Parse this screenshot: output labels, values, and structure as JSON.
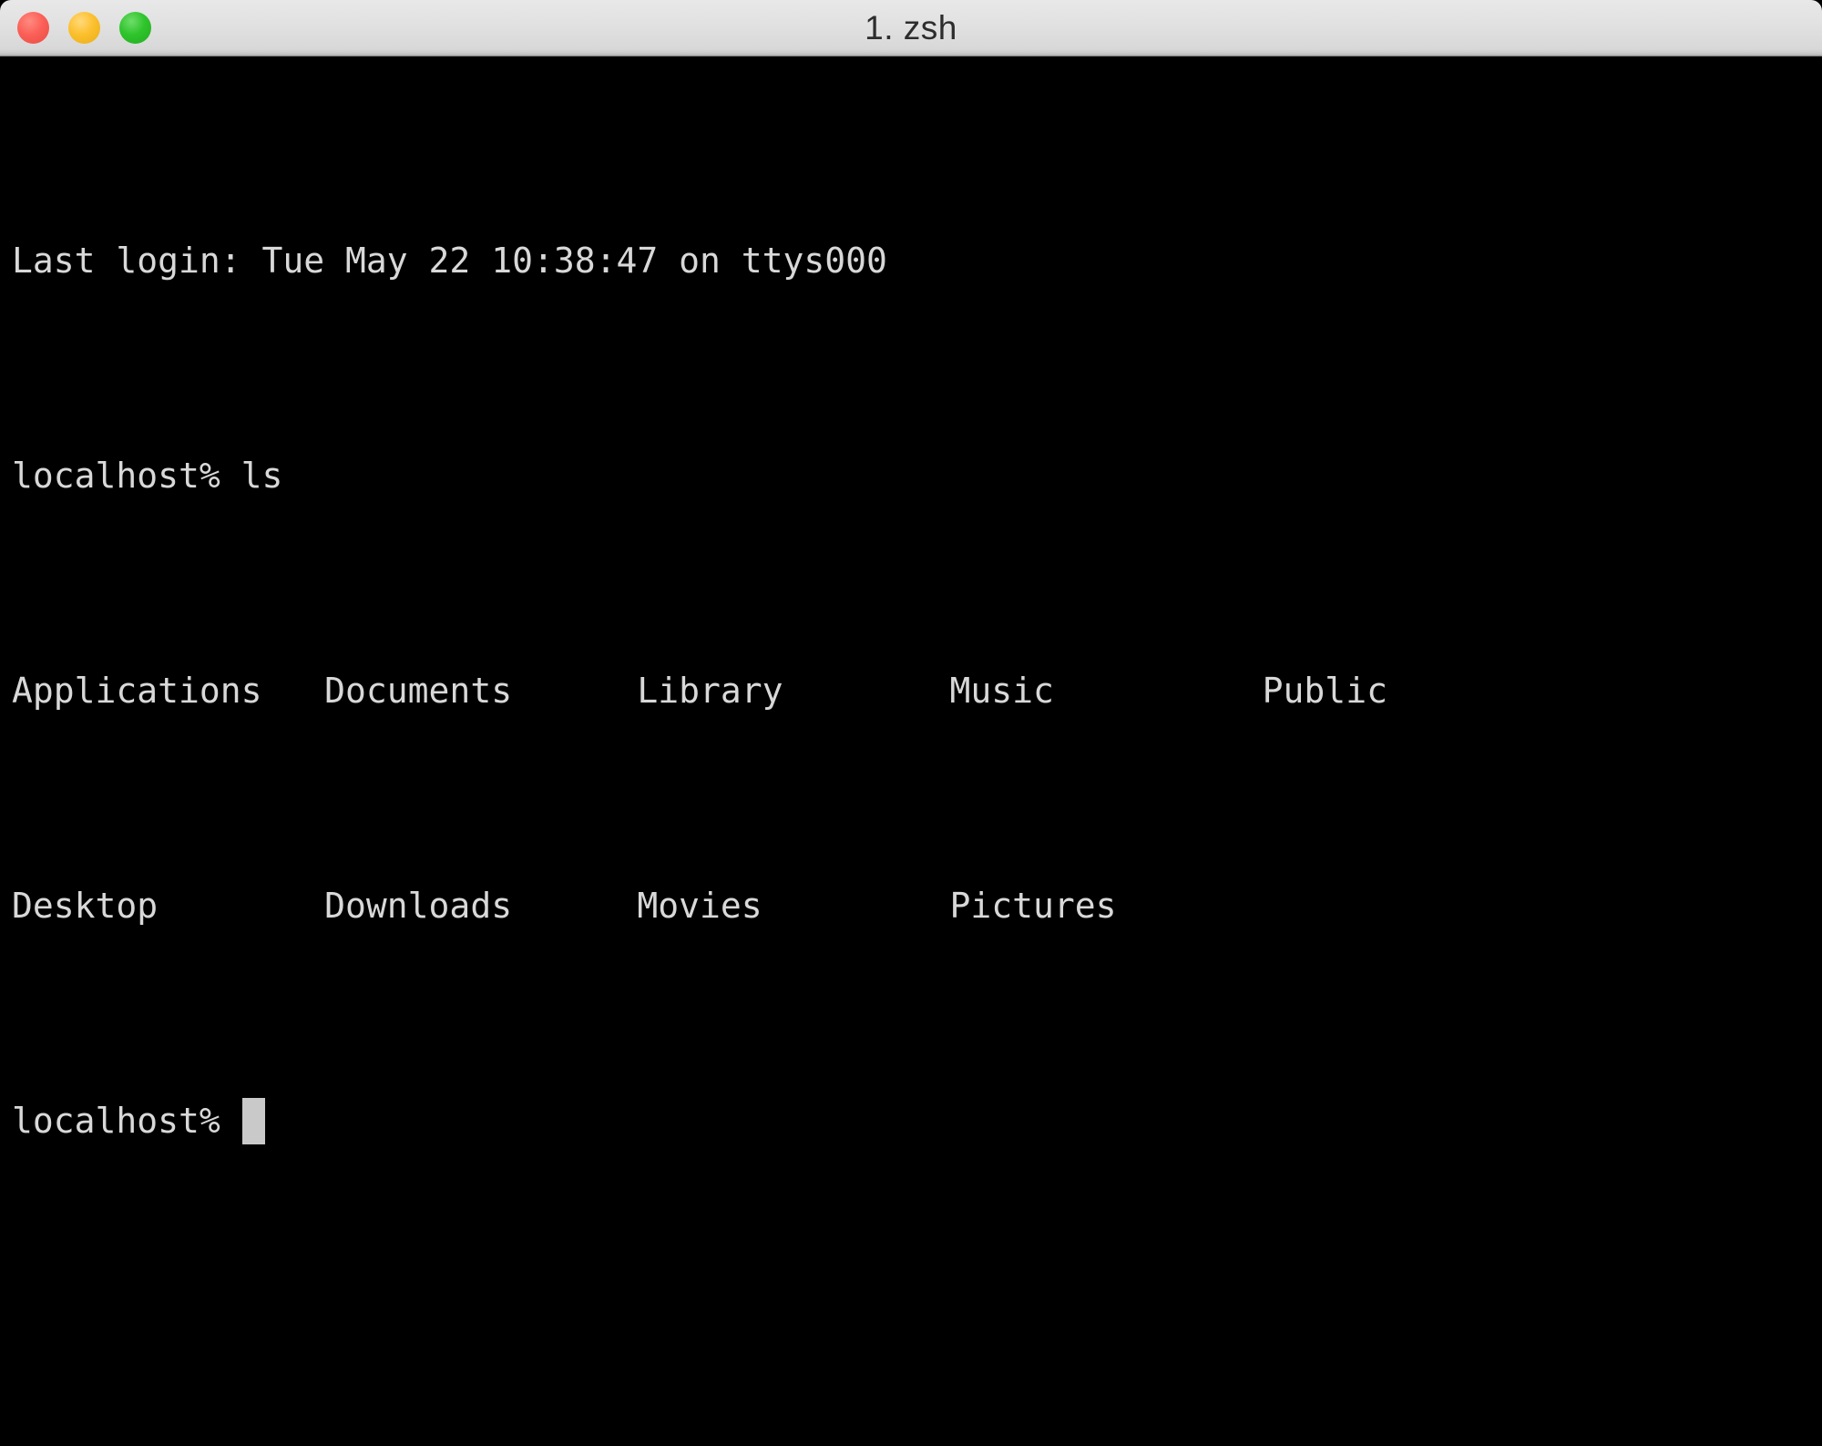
{
  "window": {
    "title": "1. zsh",
    "controls": [
      {
        "name": "close",
        "label": "Close",
        "color": "#fb6058"
      },
      {
        "name": "minimize",
        "label": "Minimize",
        "color": "#fcc02e"
      },
      {
        "name": "maximize",
        "label": "Maximize",
        "color": "#2fc42c"
      }
    ]
  },
  "terminal": {
    "background_color": "#000000",
    "text_color": "#d8d8d8",
    "cursor_color": "#c9c9c9",
    "lines": [
      {
        "kind": "output",
        "text": "Last login: Tue May 22 10:38:47 on ttys000"
      },
      {
        "kind": "command",
        "text": "localhost% ls"
      },
      {
        "kind": "ls-row",
        "text": "Applications   Documents      Library        Music          Public"
      },
      {
        "kind": "ls-row",
        "text": "Desktop        Downloads      Movies         Pictures"
      }
    ],
    "last_login": {
      "prefix": "Last login:",
      "weekday": "Tue",
      "month": "May",
      "day": "22",
      "time": "10:38:47",
      "on": "on",
      "tty": "ttys000"
    },
    "prompt": "localhost%",
    "command": "ls",
    "ls_output": {
      "columns": 5,
      "column_width_chars": 15,
      "rows": [
        [
          "Applications",
          "Documents",
          "Library",
          "Music",
          "Public"
        ],
        [
          "Desktop",
          "Downloads",
          "Movies",
          "Pictures",
          ""
        ]
      ],
      "entries": [
        "Applications",
        "Desktop",
        "Documents",
        "Downloads",
        "Library",
        "Movies",
        "Music",
        "Pictures",
        "Public"
      ]
    },
    "active_prompt": "localhost%",
    "cursor": "block"
  }
}
